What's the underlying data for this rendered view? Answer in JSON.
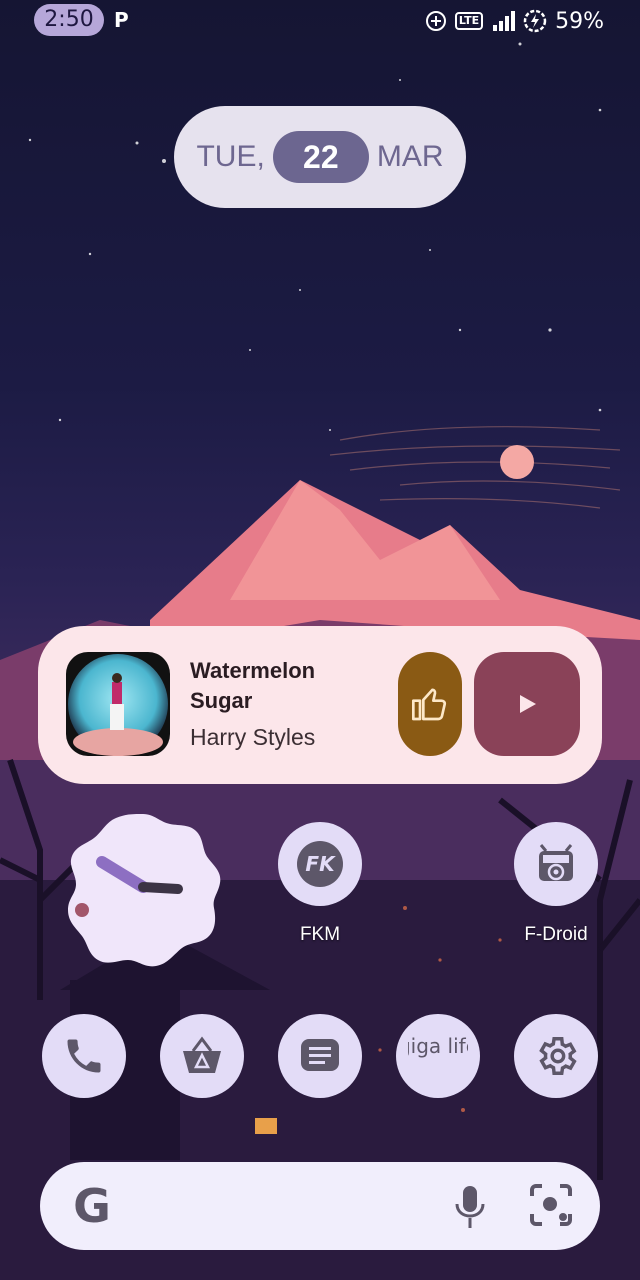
{
  "status_bar": {
    "time": "2:50",
    "notification_icon": "P",
    "icons": [
      "data-saver-icon",
      "lte-icon",
      "signal-icon",
      "battery-charging-icon"
    ],
    "lte_label": "LTE",
    "battery": "59%"
  },
  "date_widget": {
    "weekday": "TUE,",
    "day": "22",
    "month": "MAR"
  },
  "media_widget": {
    "title": "Watermelon Sugar",
    "artist": "Harry Styles",
    "icons": [
      "thumbs-up-icon",
      "play-icon"
    ]
  },
  "clock_widget": {
    "time_shown": "2:50"
  },
  "apps": [
    {
      "label": "FKM",
      "icon": "fkm-icon"
    },
    {
      "label": "F-Droid",
      "icon": "fdroid-icon"
    }
  ],
  "dock": [
    {
      "icon": "phone-icon"
    },
    {
      "icon": "app-store-icon"
    },
    {
      "icon": "messages-icon"
    },
    {
      "icon": "giga-life-icon",
      "text": "giga life"
    },
    {
      "icon": "settings-icon"
    }
  ],
  "search_bar": {
    "logo": "google-icon",
    "logo_letter": "G",
    "icons": [
      "mic-icon",
      "lens-icon"
    ]
  },
  "colors": {
    "accent": "#6c6690",
    "widget_bg": "#e6e2ee",
    "media_bg": "#fce6ea",
    "like": "#8a5a14",
    "play": "#8a4258"
  }
}
